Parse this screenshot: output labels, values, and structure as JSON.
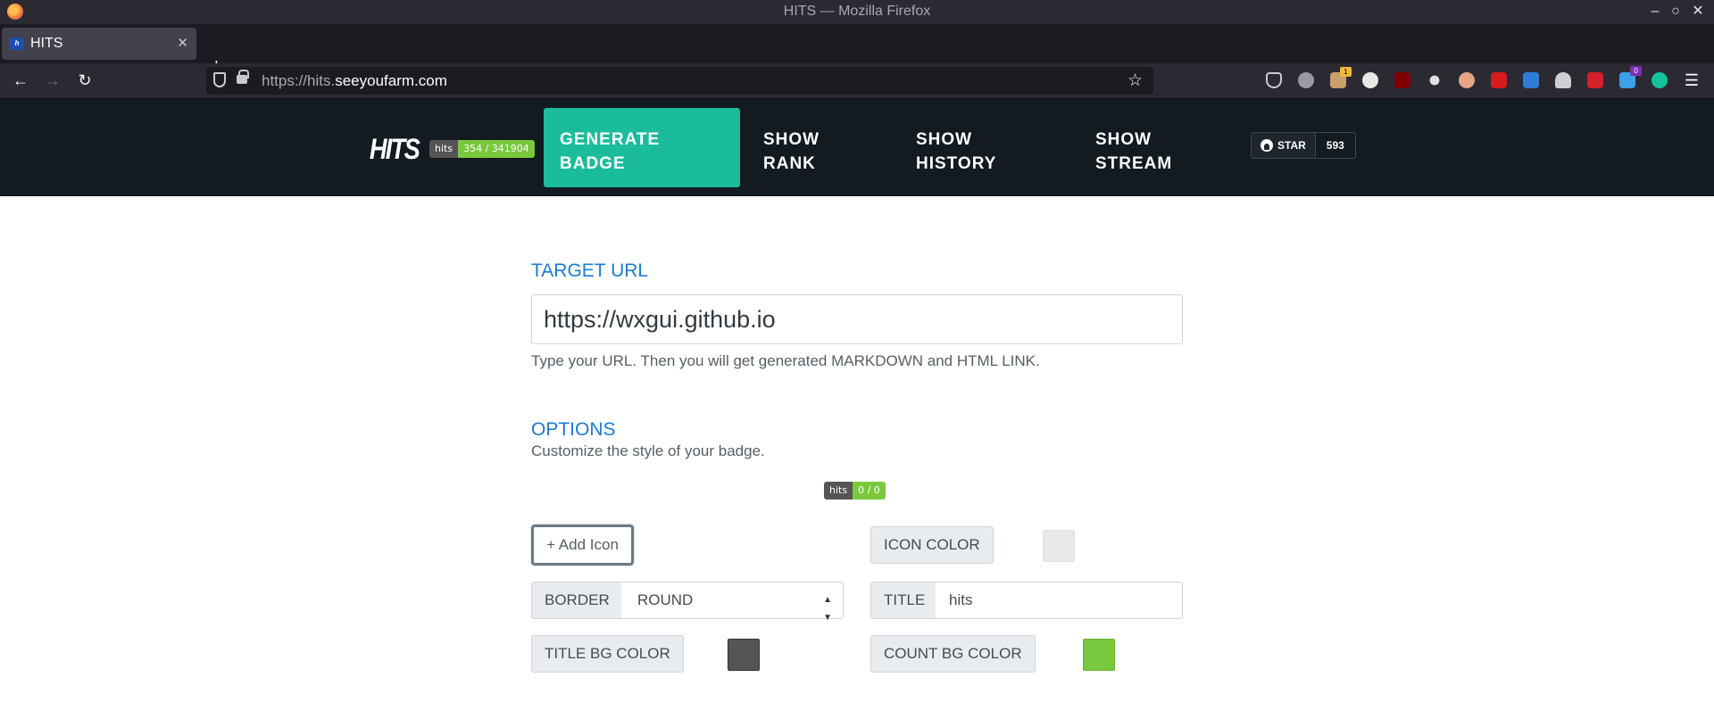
{
  "browser": {
    "window_title": "HITS — Mozilla Firefox",
    "tab_title": "HITS",
    "new_tab_label": "+",
    "url_scheme_host": "https://hits.",
    "url_domain": "seeyoufarm.com",
    "ext_badges": {
      "orange_count": "1",
      "blue_count": "0"
    }
  },
  "header": {
    "logo_text": "HITS",
    "site_badge": {
      "label": "hits",
      "value": "354 / 341904"
    },
    "nav": [
      {
        "label_line1": "GENERATE",
        "label_line2": "BADGE"
      },
      {
        "label_line1": "SHOW",
        "label_line2": "RANK"
      },
      {
        "label_line1": "SHOW",
        "label_line2": "HISTORY"
      },
      {
        "label_line1": "SHOW",
        "label_line2": "STREAM"
      }
    ],
    "github": {
      "star_label": "STAR",
      "star_count": "593"
    }
  },
  "main": {
    "target_url": {
      "heading": "TARGET URL",
      "value": "https://wxgui.github.io",
      "help": "Type your URL. Then you will get generated MARKDOWN and HTML LINK."
    },
    "options": {
      "heading": "OPTIONS",
      "subheading": "Customize the style of your badge.",
      "preview_badge": {
        "label": "hits",
        "value": "0 / 0"
      },
      "add_icon_label": "+ Add Icon",
      "icon_color_label": "ICON COLOR",
      "border_label": "BORDER",
      "border_value": "ROUND",
      "title_label": "TITLE",
      "title_value": "hits",
      "title_bg_label": "TITLE BG COLOR",
      "count_bg_label": "COUNT BG COLOR"
    }
  },
  "colors": {
    "accent": "#1abc9c",
    "header_bg": "#131a20",
    "link_blue": "#1b7bd3",
    "icon_color": "#e8e8e8",
    "title_bg_color": "#555555",
    "count_bg_color": "#79c83d"
  }
}
